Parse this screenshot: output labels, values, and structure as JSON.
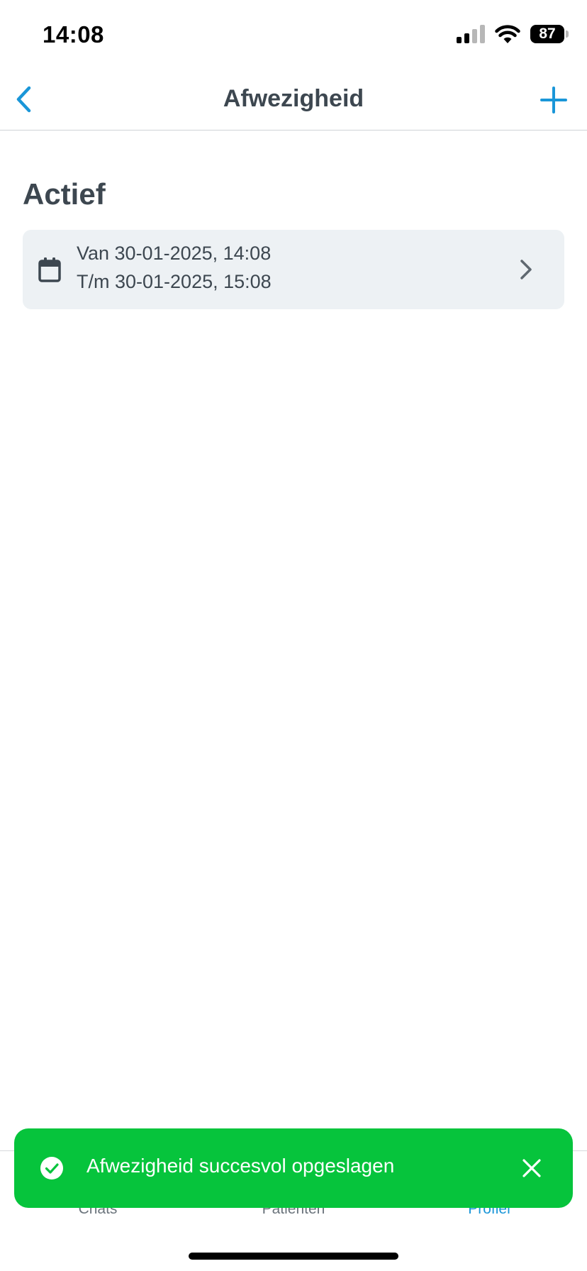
{
  "status_bar": {
    "time": "14:08",
    "battery_level": "87",
    "signal_bars_active": 2,
    "signal_bars_total": 4
  },
  "nav": {
    "title": "Afwezigheid",
    "back_icon": "chevron-left-icon",
    "add_icon": "plus-icon"
  },
  "section": {
    "title": "Actief"
  },
  "absences": [
    {
      "from": "Van 30-01-2025, 14:08",
      "until": "T/m 30-01-2025, 15:08",
      "icon": "calendar-icon"
    }
  ],
  "tabs": [
    {
      "label": "Chats",
      "active": false
    },
    {
      "label": "Patiënten",
      "active": false
    },
    {
      "label": "Profiel",
      "active": true
    }
  ],
  "toast": {
    "message": "Afwezigheid succesvol opgeslagen",
    "icon": "check-circle-icon"
  },
  "colors": {
    "accent": "#1a96d8",
    "success": "#06c43c",
    "text_primary": "#3d4750",
    "card_background": "#edf1f4"
  }
}
